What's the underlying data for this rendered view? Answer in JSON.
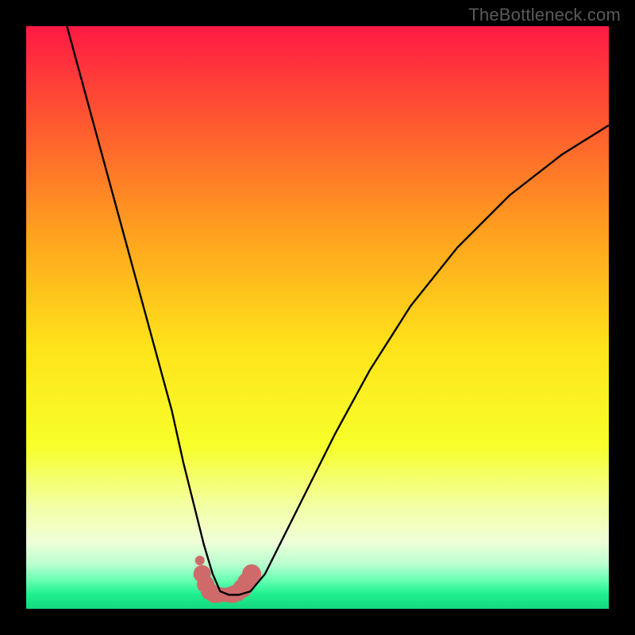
{
  "watermark": "TheBottleneck.com",
  "colors": {
    "frame": "#000000",
    "curve_stroke": "#000000",
    "marker_fill": "#cf6a6a",
    "gradient_stops": [
      {
        "offset": 0.0,
        "color": "#ff1a44"
      },
      {
        "offset": 0.17,
        "color": "#ff5a2f"
      },
      {
        "offset": 0.35,
        "color": "#ff9f1f"
      },
      {
        "offset": 0.55,
        "color": "#ffe31a"
      },
      {
        "offset": 0.72,
        "color": "#f7ff2a"
      },
      {
        "offset": 0.82,
        "color": "#f3ffa0"
      },
      {
        "offset": 0.885,
        "color": "#f0ffd8"
      },
      {
        "offset": 0.925,
        "color": "#b6ffcf"
      },
      {
        "offset": 0.952,
        "color": "#63ffb0"
      },
      {
        "offset": 0.975,
        "color": "#1fef8f"
      },
      {
        "offset": 1.0,
        "color": "#15d87e"
      }
    ]
  },
  "chart_data": {
    "type": "line",
    "title": "",
    "xlabel": "",
    "ylabel": "",
    "xlim": [
      0,
      100
    ],
    "ylim": [
      0,
      100
    ],
    "grid": false,
    "legend": false,
    "series": [
      {
        "name": "bottleneck-curve",
        "x": [
          7,
          10,
          13,
          16,
          19,
          22,
          25,
          27,
          29,
          30.5,
          32,
          33.3,
          34.8,
          36.5,
          38.5,
          41,
          44,
          48,
          53,
          59,
          66,
          74,
          83,
          92,
          100
        ],
        "y": [
          100,
          89,
          78,
          67,
          56,
          45,
          34,
          25,
          17,
          11,
          6,
          3,
          2.4,
          2.4,
          3,
          6,
          12,
          20,
          30,
          41,
          52,
          62,
          71,
          78,
          83
        ]
      }
    ],
    "markers": {
      "name": "highlight-band",
      "x": [
        29.8,
        30.2,
        30.8,
        31.5,
        32.3,
        33.0,
        33.4,
        33.9,
        34.4,
        35.0,
        35.6,
        36.3,
        37.1,
        37.9,
        38.7
      ],
      "y": [
        8.3,
        6.0,
        4.2,
        3.0,
        2.5,
        2.4,
        2.4,
        2.4,
        2.4,
        2.4,
        2.5,
        2.8,
        3.5,
        4.6,
        6.0
      ],
      "r": [
        6,
        11,
        11,
        11,
        11,
        10,
        9,
        9,
        9,
        10,
        11,
        11,
        12,
        12,
        12
      ]
    }
  }
}
